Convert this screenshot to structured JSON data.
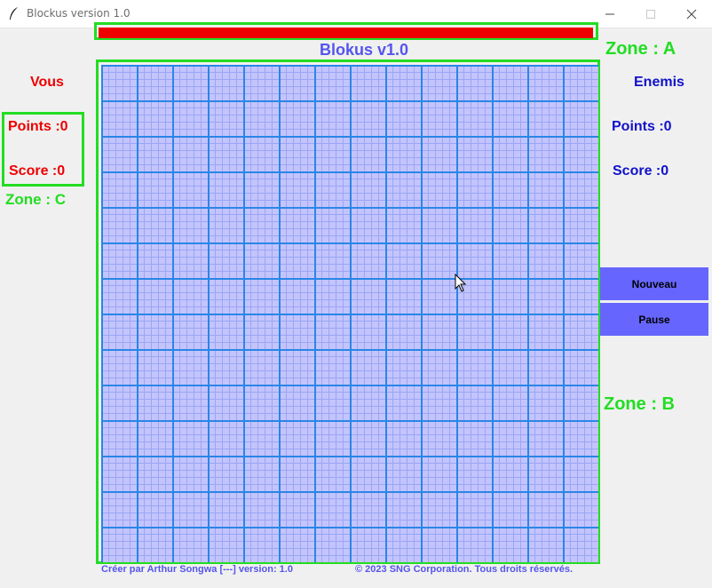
{
  "window": {
    "title": "Blockus version 1.0",
    "app_icon": "feather-icon",
    "controls": [
      "minimize-icon",
      "maximize-icon",
      "close-icon"
    ]
  },
  "progress": {
    "fill_fraction": 0.995,
    "fill_color": "#ee0000"
  },
  "game_title": "Blokus v1.0",
  "zones": {
    "a": "Zone : A",
    "b": "Zone : B",
    "c": "Zone : C"
  },
  "player": {
    "label": "Vous",
    "points": "Points :0",
    "score": "Score :0",
    "color": "#ee0000"
  },
  "enemy": {
    "label": "Enemis",
    "points": "Points :0",
    "score": "Score :0",
    "color": "#1111cc"
  },
  "buttons": {
    "new": "Nouveau",
    "pause": "Pause"
  },
  "board": {
    "rows": 14,
    "cols": 14,
    "subdivisions": 5,
    "fill": "#c4c4fd",
    "grid_color": "#2a86e6"
  },
  "footer": {
    "credit": "Créer par Arthur Songwa [---] version: 1.0",
    "copyright": "© 2023 SNG Corporation. Tous droits réservés."
  },
  "accent_colors": {
    "zone": "#22dd22",
    "title": "#5555ee",
    "button": "#6666ff"
  }
}
